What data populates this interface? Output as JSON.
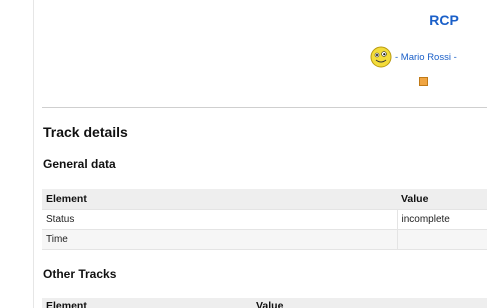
{
  "header": {
    "app_title": "RCP",
    "user_text": "- Mario Rossi -"
  },
  "track": {
    "title": "Track details",
    "general_heading": "General data",
    "general_table": {
      "columns": [
        "Element",
        "Value"
      ],
      "rows": [
        {
          "element": "Status",
          "value": "incomplete"
        },
        {
          "element": "Time",
          "value": ""
        }
      ]
    },
    "other_heading": "Other Tracks",
    "other_table": {
      "columns": [
        "Element",
        "Value"
      ]
    }
  },
  "icons": {
    "avatar": "smiley-icon",
    "messages": "message-icon"
  },
  "colors": {
    "link": "#1a5fc8",
    "table_header": "#eeeeee"
  }
}
